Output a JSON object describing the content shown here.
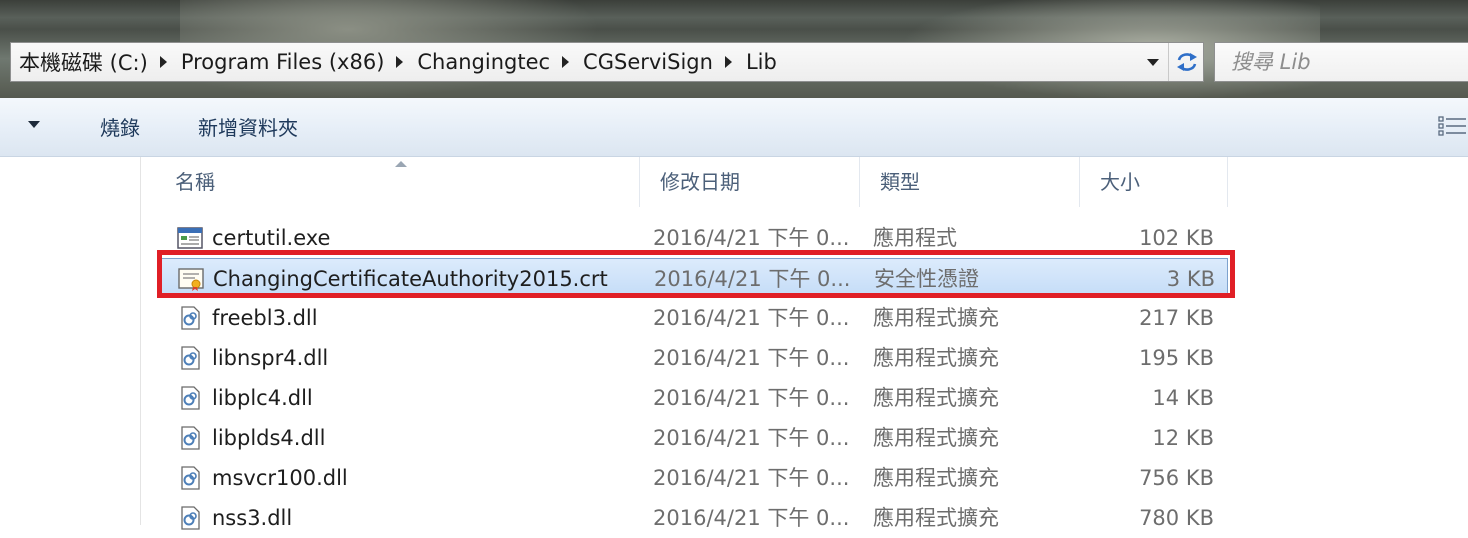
{
  "address_bar": {
    "breadcrumbs": [
      {
        "label": "本機磁碟 (C:)"
      },
      {
        "label": "Program Files (x86)"
      },
      {
        "label": "Changingtec"
      },
      {
        "label": "CGServiSign"
      },
      {
        "label": "Lib"
      }
    ],
    "search_placeholder": "搜尋 Lib"
  },
  "command_bar": {
    "burn_label": "燒錄",
    "new_folder_label": "新增資料夾"
  },
  "columns": {
    "name": "名稱",
    "date_modified": "修改日期",
    "type": "類型",
    "size": "大小"
  },
  "files": [
    {
      "name": "certutil.exe",
      "date": "2016/4/21 下午 0...",
      "type": "應用程式",
      "size": "102 KB",
      "icon": "exe-icon"
    },
    {
      "name": "ChangingCertificateAuthority2015.crt",
      "date": "2016/4/21 下午 0...",
      "type": "安全性憑證",
      "size": "3 KB",
      "icon": "certificate-icon",
      "selected": true
    },
    {
      "name": "freebl3.dll",
      "date": "2016/4/21 下午 0...",
      "type": "應用程式擴充",
      "size": "217 KB",
      "icon": "dll-icon"
    },
    {
      "name": "libnspr4.dll",
      "date": "2016/4/21 下午 0...",
      "type": "應用程式擴充",
      "size": "195 KB",
      "icon": "dll-icon"
    },
    {
      "name": "libplc4.dll",
      "date": "2016/4/21 下午 0...",
      "type": "應用程式擴充",
      "size": "14 KB",
      "icon": "dll-icon"
    },
    {
      "name": "libplds4.dll",
      "date": "2016/4/21 下午 0...",
      "type": "應用程式擴充",
      "size": "12 KB",
      "icon": "dll-icon"
    },
    {
      "name": "msvcr100.dll",
      "date": "2016/4/21 下午 0...",
      "type": "應用程式擴充",
      "size": "756 KB",
      "icon": "dll-icon"
    },
    {
      "name": "nss3.dll",
      "date": "2016/4/21 下午 0...",
      "type": "應用程式擴充",
      "size": "780 KB",
      "icon": "dll-icon"
    }
  ],
  "colors": {
    "highlight_border": "#e01f26",
    "selection_fill": "#c4dcf7",
    "command_bar_text": "#1e395b"
  }
}
